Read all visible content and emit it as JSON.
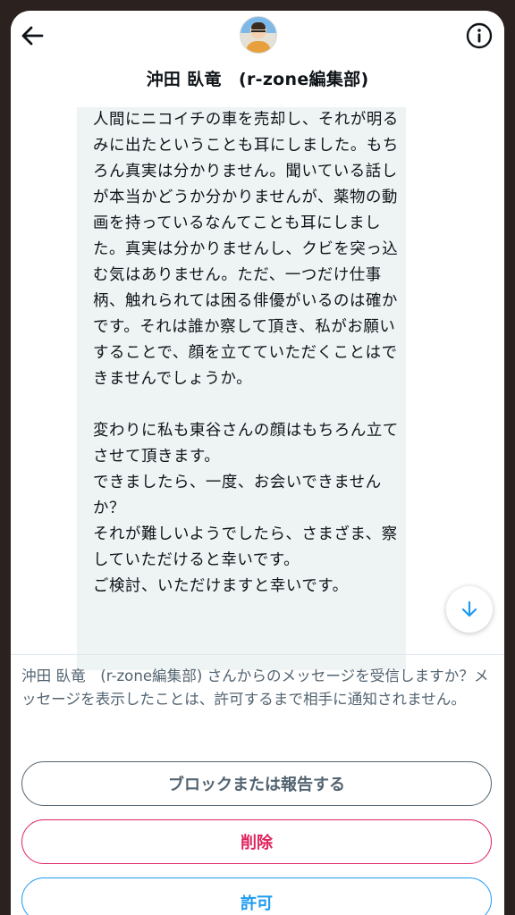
{
  "header": {
    "title": "沖田 臥竜　(r-zone編集部)",
    "back_icon": "arrow-left-icon",
    "info_icon": "info-circle-icon"
  },
  "message": {
    "text": "人間にニコイチの車を売却し、それが明るみに出たということも耳にしました。もちろん真実は分かりません。聞いている話しが本当かどうか分かりませんが、薬物の動画を持っているなんてことも耳にしました。真実は分かりませんし、クビを突っ込む気はありません。ただ、一つだけ仕事柄、触れられては困る俳優がいるのは確かです。それは誰か察して頂き、私がお願いすることで、顔を立てていただくことはできませんでしょうか。\n\n変わりに私も東谷さんの顔はもちろん立てさせて頂きます。\nできましたら、一度、お会いできませんか？\nそれが難しいようでしたら、さまざま、察していただけると幸いです。\nご検討、いただけますと幸いです。"
  },
  "request": {
    "prompt": "沖田 臥竜　(r-zone編集部) さんからのメッセージを受信しますか？メッセージを表示したことは、許可するまで相手に通知されません。",
    "block_label": "ブロックまたは報告する",
    "delete_label": "削除",
    "allow_label": "許可"
  },
  "colors": {
    "accent": "#1d9bf0",
    "danger": "#e0245e",
    "muted": "#536471",
    "bubble": "#eef3f4"
  }
}
